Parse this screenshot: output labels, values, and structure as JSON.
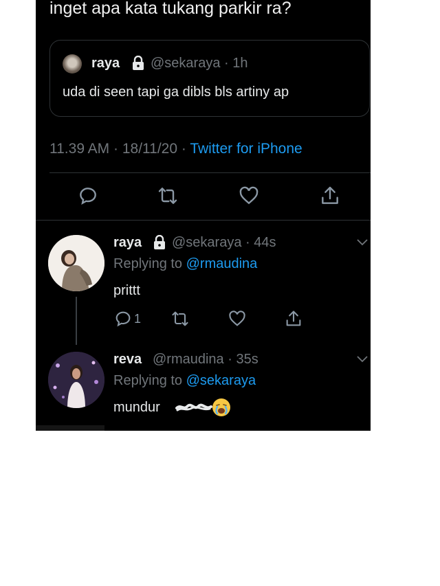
{
  "tweet": {
    "text": "inget apa kata tukang parkir ra?",
    "quote": {
      "name": "raya",
      "handle_time": "@sekaraya · 1h",
      "body": "uda di seen tapi ga dibls bls artiny ap"
    },
    "meta": {
      "time_date": "11.39 AM · 18/11/20 · ",
      "source": "Twitter for iPhone"
    },
    "actions": [
      "reply-icon",
      "retweet-icon",
      "like-icon",
      "share-icon"
    ]
  },
  "replies": [
    {
      "name": "raya",
      "handle_time": "@sekaraya · 44s",
      "replying_prefix": "Replying to ",
      "replying_to": "@rmaudina",
      "body": "prittt",
      "reply_count": "1"
    },
    {
      "name": "reva",
      "handle_time": "@rmaudina · 35s",
      "replying_prefix": "Replying to ",
      "replying_to": "@sekaraya",
      "body": "mundur"
    }
  ],
  "colors": {
    "background": "#000000",
    "text": "#e7e9ea",
    "muted": "#71767b",
    "link": "#1d9bf0",
    "divider": "#2f3336"
  }
}
